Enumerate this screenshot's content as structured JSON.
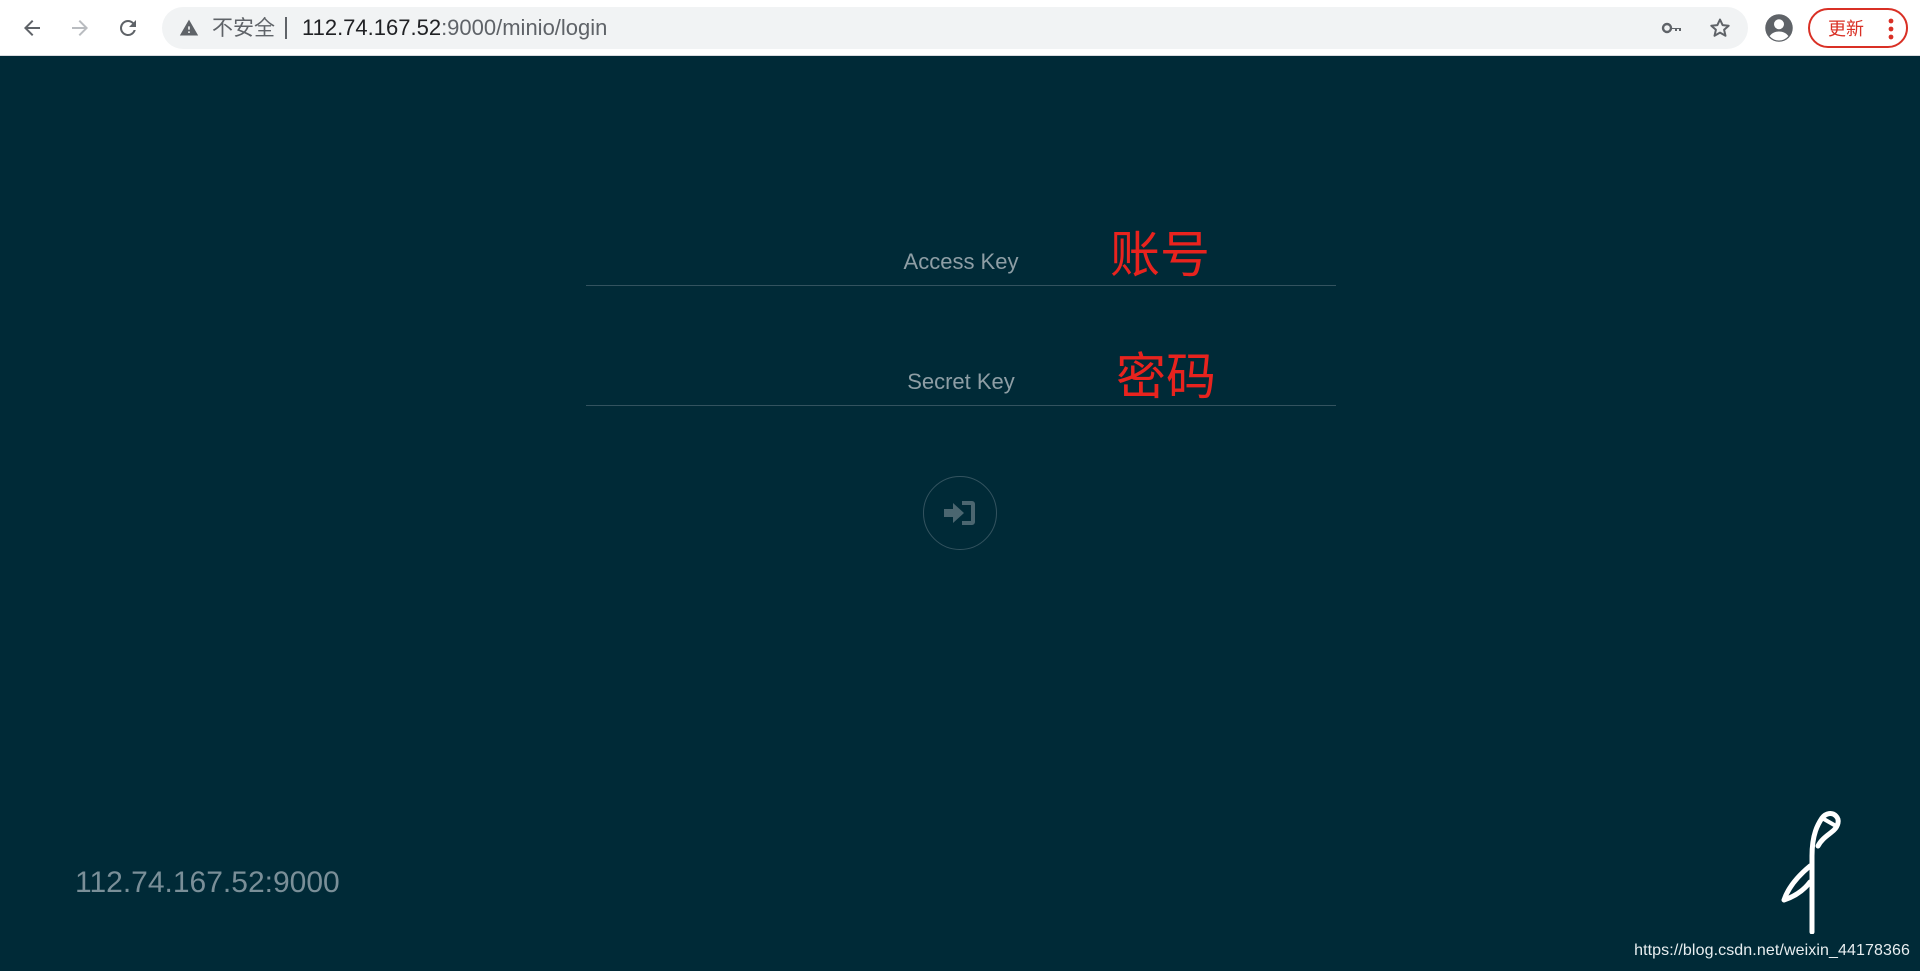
{
  "browser": {
    "security_label": "不安全",
    "url_host": "112.74.167.52",
    "url_rest": ":9000/minio/login",
    "update_label": "更新"
  },
  "login": {
    "access_key_placeholder": "Access Key",
    "secret_key_placeholder": "Secret Key",
    "access_key_annotation": "账号",
    "secret_key_annotation": "密码",
    "login_icon": "sign-in-icon"
  },
  "footer": {
    "host": "112.74.167.52:9000",
    "logo_icon": "minio-logo-icon"
  },
  "watermark": "https://blog.csdn.net/weixin_44178366",
  "colors": {
    "background": "#002a37",
    "annotation": "#e8231e",
    "update_accent": "#d93025"
  }
}
